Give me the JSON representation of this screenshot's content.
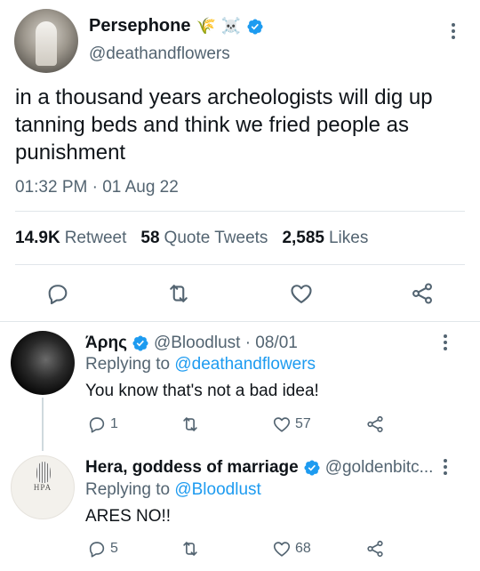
{
  "main_tweet": {
    "display_name": "Persephone",
    "name_emoji": [
      "🌾",
      "☠️"
    ],
    "handle": "@deathandflowers",
    "text": "in a thousand years archeologists will dig up tanning beds and think we fried people as punishment",
    "timestamp": "01:32 PM · 01 Aug 22",
    "stats": {
      "retweets_count": "14.9K",
      "retweets_label": "Retweet",
      "quotes_count": "58",
      "quotes_label": "Quote Tweets",
      "likes_count": "2,585",
      "likes_label": "Likes"
    }
  },
  "replies": [
    {
      "display_name": "Άρης",
      "handle_date": "@Bloodlust · 08/01",
      "replying_prefix": "Replying to",
      "replying_to": "@deathandflowers",
      "text": "You know that's not a bad idea!",
      "reply_count": "1",
      "retweet_count": "",
      "like_count": "57"
    },
    {
      "display_name": "Hera, goddess of marriage",
      "handle_date": "@goldenbitc...",
      "avatar_text": "HPA",
      "replying_prefix": "Replying to",
      "replying_to": "@Bloodlust",
      "text": "ARES NO!!",
      "reply_count": "5",
      "retweet_count": "",
      "like_count": "68"
    }
  ],
  "colors": {
    "accent": "#1d9bf0",
    "text_primary": "#0f1419",
    "text_secondary": "#536471",
    "divider": "#e1e6ea"
  },
  "icons": [
    "verified-badge-icon",
    "more-options-icon",
    "reply-icon",
    "retweet-icon",
    "like-icon",
    "share-icon"
  ]
}
